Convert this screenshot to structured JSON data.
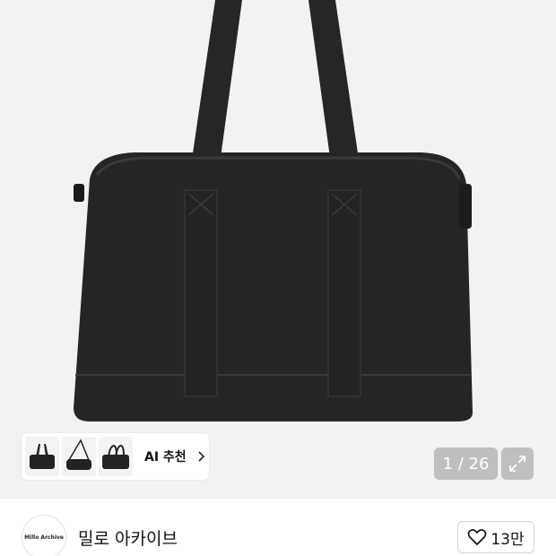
{
  "gallery": {
    "counter": "1 / 26"
  },
  "ai_recommend": {
    "label": "AI 추천",
    "thumbnails": [
      "black-duffel-bag",
      "black-crossbody-bag",
      "black-tote-bag"
    ]
  },
  "shop": {
    "logo_text": "Millo Archive",
    "name": "밀로 아카이브"
  },
  "like": {
    "count": "13만"
  },
  "colors": {
    "hero_bg": "#f2f2f2",
    "bag": "#242424",
    "overlay": "#969696"
  },
  "icons": {
    "chevron": "chevron-right-icon",
    "expand": "expand-icon",
    "heart": "heart-outline-icon"
  }
}
